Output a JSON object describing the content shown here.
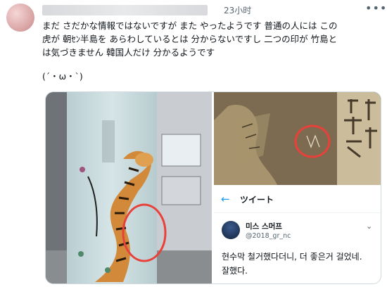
{
  "tweet": {
    "time": "23小时",
    "more_icon": "more-dots-icon",
    "text": "まだ さだかな情報ではないですが また やったようです 普通の人には この\n虎が 朝ｾﾝ半島を あらわしているとは 分からないですし 二つの印が 竹島と\nは気づきません 韓国人だけ 分かるようです",
    "kaomoji": "(´・ω・`)"
  },
  "media": {
    "quoted_tweet": {
      "back_icon": "back-arrow-icon",
      "header": "ツイート",
      "name": "미스 스머프",
      "handle": "@2018_gr_nc",
      "text": "현수막 철거했다더니, 더 좋은거 걸었네.\n잘했다."
    }
  },
  "colors": {
    "accent": "#1d9bf0",
    "red_circle": "#e8413a",
    "text_secondary": "#536471"
  }
}
